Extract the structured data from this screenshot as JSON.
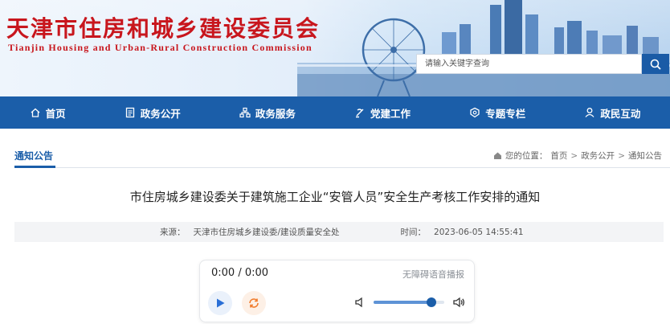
{
  "header": {
    "site_name_cn": "天津市住房和城乡建设委员会",
    "site_name_en": "Tianjin Housing and Urban-Rural Construction Commission",
    "search_placeholder": "请输入关键字查询",
    "search_icon": "search-icon",
    "brand_color": "#c8161d"
  },
  "nav": {
    "bg_color": "#1b5ea9",
    "items": [
      {
        "label": "首页",
        "icon": "home-icon"
      },
      {
        "label": "政务公开",
        "icon": "document-icon"
      },
      {
        "label": "政务服务",
        "icon": "network-icon"
      },
      {
        "label": "党建工作",
        "icon": "party-icon"
      },
      {
        "label": "专题专栏",
        "icon": "badge-icon"
      },
      {
        "label": "政民互动",
        "icon": "user-icon"
      }
    ]
  },
  "breadcrumb": {
    "section_title": "通知公告",
    "location_label": "您的位置：",
    "path": [
      "首页",
      "政务公开",
      "通知公告"
    ],
    "separator": ">"
  },
  "article": {
    "title": "市住房城乡建设委关于建筑施工企业“安管人员”安全生产考核工作安排的通知",
    "source_label": "来源：",
    "source_value": "天津市住房城乡建设委/建设质量安全处",
    "time_label": "时间：",
    "time_value": "2023-06-05 14:55:41"
  },
  "player": {
    "time_display": "0:00 / 0:00",
    "a11y_label": "无障碍语音播报",
    "volume_fraction": 0.82
  }
}
